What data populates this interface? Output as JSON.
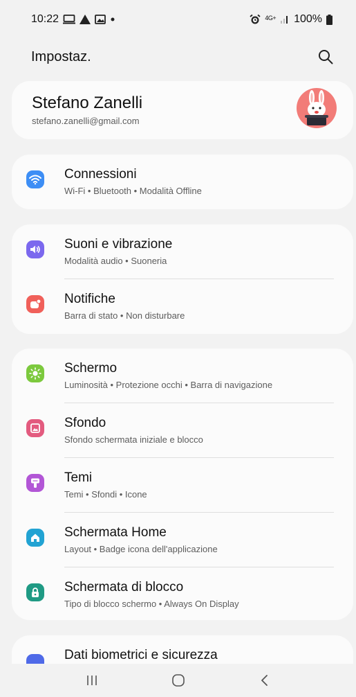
{
  "status_bar": {
    "time": "10:22",
    "network": "4G+",
    "battery": "100%"
  },
  "header": {
    "title": "Impostaz."
  },
  "profile": {
    "name": "Stefano Zanelli",
    "email": "stefano.zanelli@gmail.com"
  },
  "groups": [
    {
      "items": [
        {
          "title": "Connessioni",
          "subtitle": "Wi-Fi  •  Bluetooth  •  Modalità Offline",
          "icon": "wifi-icon",
          "color": "#3d8ef5"
        }
      ]
    },
    {
      "items": [
        {
          "title": "Suoni e vibrazione",
          "subtitle": "Modalità audio  •  Suoneria",
          "icon": "sound-icon",
          "color": "#7b68ee"
        },
        {
          "title": "Notifiche",
          "subtitle": "Barra di stato  •  Non disturbare",
          "icon": "notification-icon",
          "color": "#f0605a"
        }
      ]
    },
    {
      "items": [
        {
          "title": "Schermo",
          "subtitle": "Luminosità  •  Protezione occhi  •  Barra di navigazione",
          "icon": "brightness-icon",
          "color": "#7cc93d"
        },
        {
          "title": "Sfondo",
          "subtitle": "Sfondo schermata iniziale e blocco",
          "icon": "wallpaper-icon",
          "color": "#e35b7f"
        },
        {
          "title": "Temi",
          "subtitle": "Temi  •  Sfondi  •  Icone",
          "icon": "themes-icon",
          "color": "#b256d6"
        },
        {
          "title": "Schermata Home",
          "subtitle": "Layout  •  Badge icona dell'applicazione",
          "icon": "home-icon",
          "color": "#22a3d3"
        },
        {
          "title": "Schermata di blocco",
          "subtitle": "Tipo di blocco schermo  •  Always On Display",
          "icon": "lock-icon",
          "color": "#1f9a84"
        }
      ]
    },
    {
      "items": [
        {
          "title": "Dati biometrici e sicurezza",
          "subtitle": "",
          "icon": "biometrics-icon",
          "color": "#4f6ae8"
        }
      ]
    }
  ]
}
